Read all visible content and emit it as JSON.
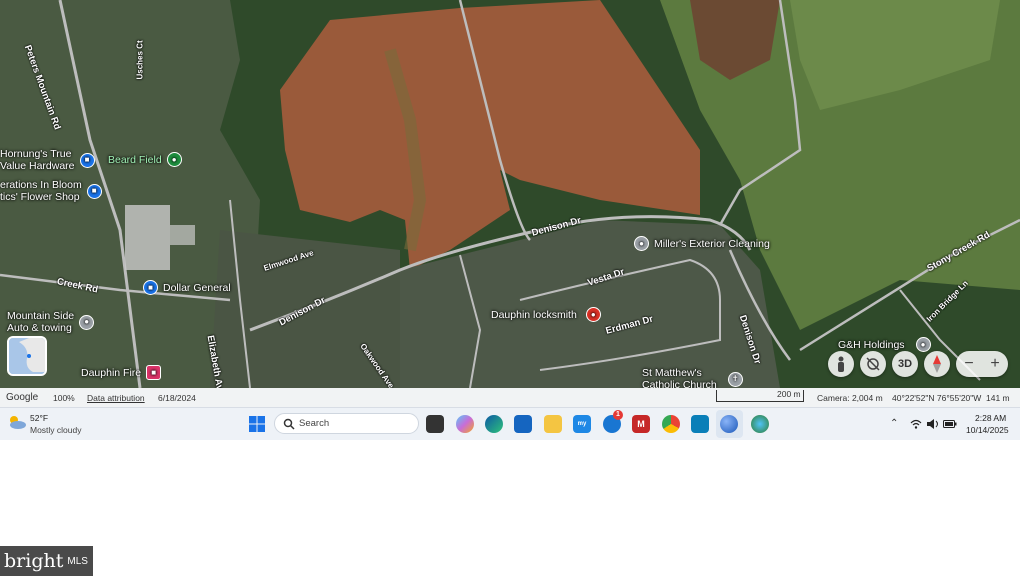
{
  "map": {
    "road_labels": {
      "peters_mountain_rd": "Peters Mountain Rd",
      "usches_ct": "Usches Ct",
      "creek_rd": "Creek Rd",
      "elmwood_ave": "Elmwood Ave",
      "elizabeth_ave": "Elizabeth Ave",
      "denison_dr_west": "Denison Dr",
      "denison_dr_north": "Denison Dr",
      "denison_dr_east": "Denison Dr",
      "vesta_dr": "Vesta Dr",
      "erdman_dr": "Erdman Dr",
      "oakwood_ave": "Oakwood Ave",
      "stony_creek_rd": "Stony Creek Rd",
      "iron_bridge_ln": "Iron Bridge Ln"
    },
    "places": {
      "hornungs_line1": "Hornung's True",
      "hornungs_line2": "Value Hardware",
      "beard_field": "Beard Field",
      "creations_line1": "erations In Bloom",
      "creations_line2": "tics' Flower Shop",
      "dollar_general": "Dollar General",
      "mountain_side_line1": "Mountain Side",
      "mountain_side_line2": "Auto & towing",
      "dauphin_fire": "Dauphin Fire",
      "millers": "Miller's Exterior Cleaning",
      "dauphin_locksmith": "Dauphin locksmith",
      "st_matthews_line1": "St Matthew's",
      "st_matthews_line2": "Catholic Church",
      "gh_holdings": "G&H Holdings"
    },
    "controls": {
      "three_d": "3D",
      "zoom_out": "−",
      "zoom_in": "+"
    },
    "colors": {
      "field_brown": "#9a5a3a",
      "forest": "#2f4a2a",
      "pasture": "#5c7a3f"
    }
  },
  "statusbar": {
    "brand": "Google",
    "zoom": "100%",
    "data_attribution": "Data attribution",
    "date": "6/18/2024",
    "scale": "200 m",
    "camera": "Camera: 2,004 m",
    "coords": "40°22'52\"N 76°55'20\"W",
    "elevation": "141 m"
  },
  "taskbar": {
    "weather_temp": "52°F",
    "weather_desc": "Mostly cloudy",
    "search_placeholder": "Search",
    "notification_count": "1",
    "time": "2:28 AM",
    "date": "10/14/2025"
  },
  "watermark": {
    "brand": "bright",
    "suffix": "MLS"
  }
}
